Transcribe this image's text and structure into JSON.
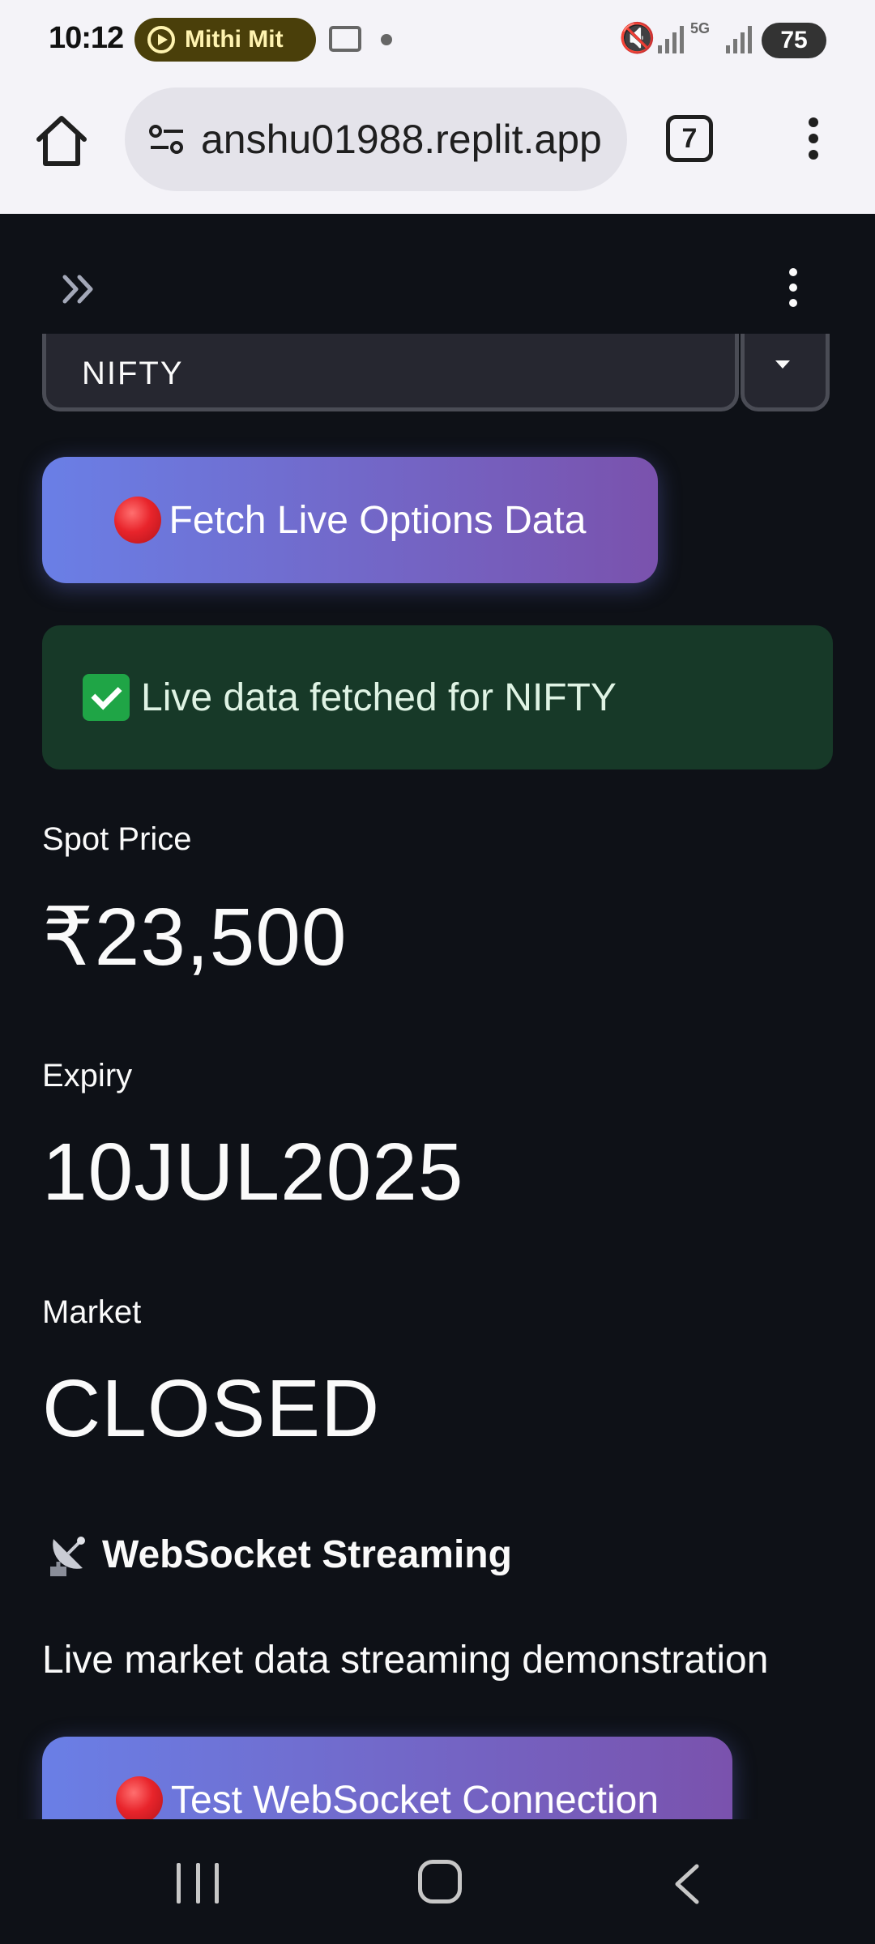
{
  "status_bar": {
    "time": "10:12",
    "media_chip": "Mithi Mit",
    "network_label": "5G",
    "battery": "75"
  },
  "browser": {
    "url": "anshu01988.replit.app",
    "tab_count": "7"
  },
  "app": {
    "symbol_select": {
      "value": "NIFTY"
    },
    "fetch_button": {
      "label": "Fetch Live Options Data"
    },
    "success_alert": {
      "text": "Live data fetched for NIFTY"
    },
    "metrics": [
      {
        "label": "Spot Price",
        "value": "₹23,500"
      },
      {
        "label": "Expiry",
        "value": "10JUL2025"
      },
      {
        "label": "Market",
        "value": "CLOSED"
      }
    ],
    "websocket": {
      "title": "WebSocket Streaming",
      "description": "Live market data streaming demonstration",
      "test_button": {
        "label": "Test WebSocket Connection"
      }
    }
  },
  "colors": {
    "app_background": "#0e1117",
    "button_gradient_start": "#6a7fe6",
    "button_gradient_end": "#7a52ad",
    "success_background": "#173928",
    "browser_chrome": "#f4f3f8"
  }
}
